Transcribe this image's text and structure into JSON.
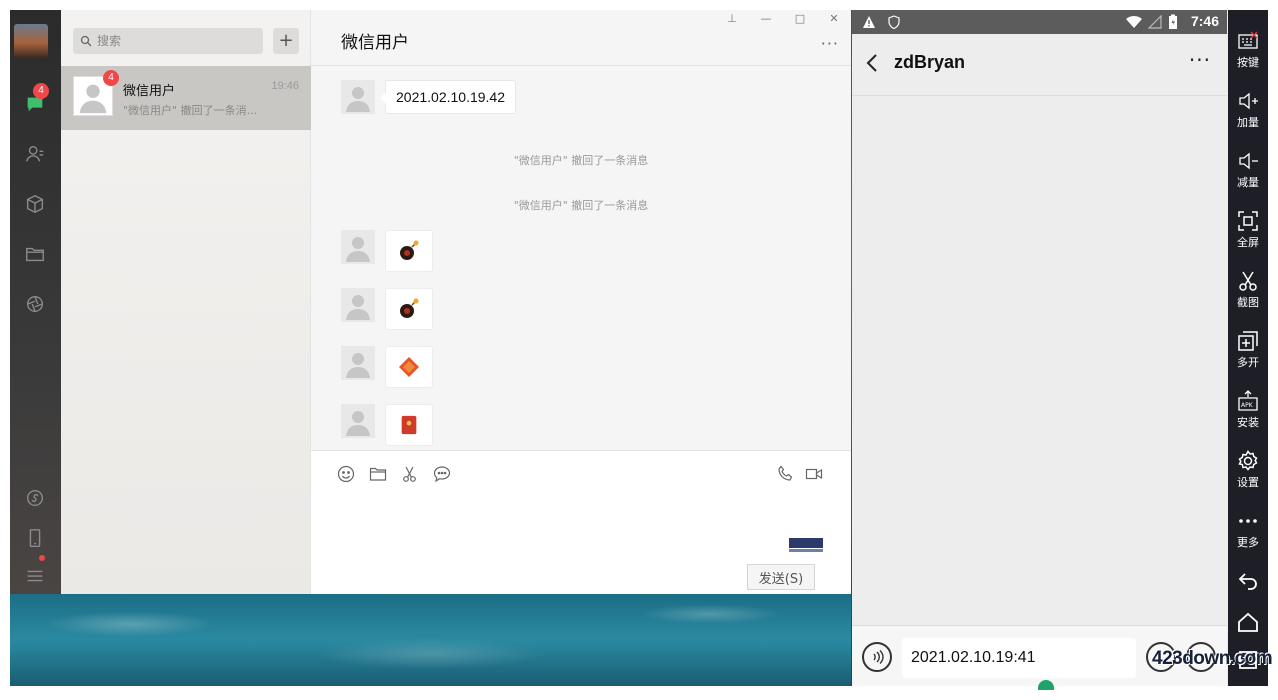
{
  "wechat": {
    "nav": {
      "chat_badge": "4"
    },
    "search": {
      "placeholder": "搜索"
    },
    "add_button_label": "+",
    "session": {
      "name": "微信用户",
      "time": "19:46",
      "badge": "4",
      "preview": "\"微信用户\" 撤回了一条消..."
    },
    "chat": {
      "title": "微信用户",
      "more_label": "···",
      "window_controls": {
        "pin": "⊥",
        "minimize": "—",
        "maximize": "□",
        "close": "✕"
      },
      "messages": [
        {
          "type": "text",
          "text": "2021.02.10.19.42"
        },
        {
          "type": "system",
          "text": "\"微信用户\" 撤回了一条消息"
        },
        {
          "type": "system",
          "text": "\"微信用户\" 撤回了一条消息"
        },
        {
          "type": "sticker",
          "sticker": "bomb-icon"
        },
        {
          "type": "sticker",
          "sticker": "bomb-icon"
        },
        {
          "type": "sticker",
          "sticker": "fu-diamond-icon"
        },
        {
          "type": "sticker",
          "sticker": "red-envelope-icon"
        }
      ]
    },
    "input": {
      "send_label": "发送(S)"
    }
  },
  "emulator": {
    "status": {
      "time": "7:46"
    },
    "chat": {
      "contact_name": "zdBryan",
      "more_label": "···",
      "input_value": "2021.02.10.19:41"
    },
    "toolbar": {
      "items": [
        {
          "label": "按键",
          "icon": "keyboard-icon"
        },
        {
          "label": "加量",
          "icon": "volume-up-icon"
        },
        {
          "label": "减量",
          "icon": "volume-down-icon"
        },
        {
          "label": "全屏",
          "icon": "fullscreen-icon"
        },
        {
          "label": "截图",
          "icon": "scissors-icon"
        },
        {
          "label": "多开",
          "icon": "multi-instance-icon"
        },
        {
          "label": "安装",
          "icon": "apk-install-icon"
        },
        {
          "label": "设置",
          "icon": "gear-icon"
        },
        {
          "label": "更多",
          "icon": "more-dots-icon"
        }
      ]
    }
  },
  "watermark": {
    "text": "423down.com"
  },
  "colors": {
    "badge_red": "#f04848",
    "emulator_toolbar": "#1e1f26",
    "android_status_bar": "#5c5c5c",
    "cursor_handle": "#1fa36a"
  }
}
